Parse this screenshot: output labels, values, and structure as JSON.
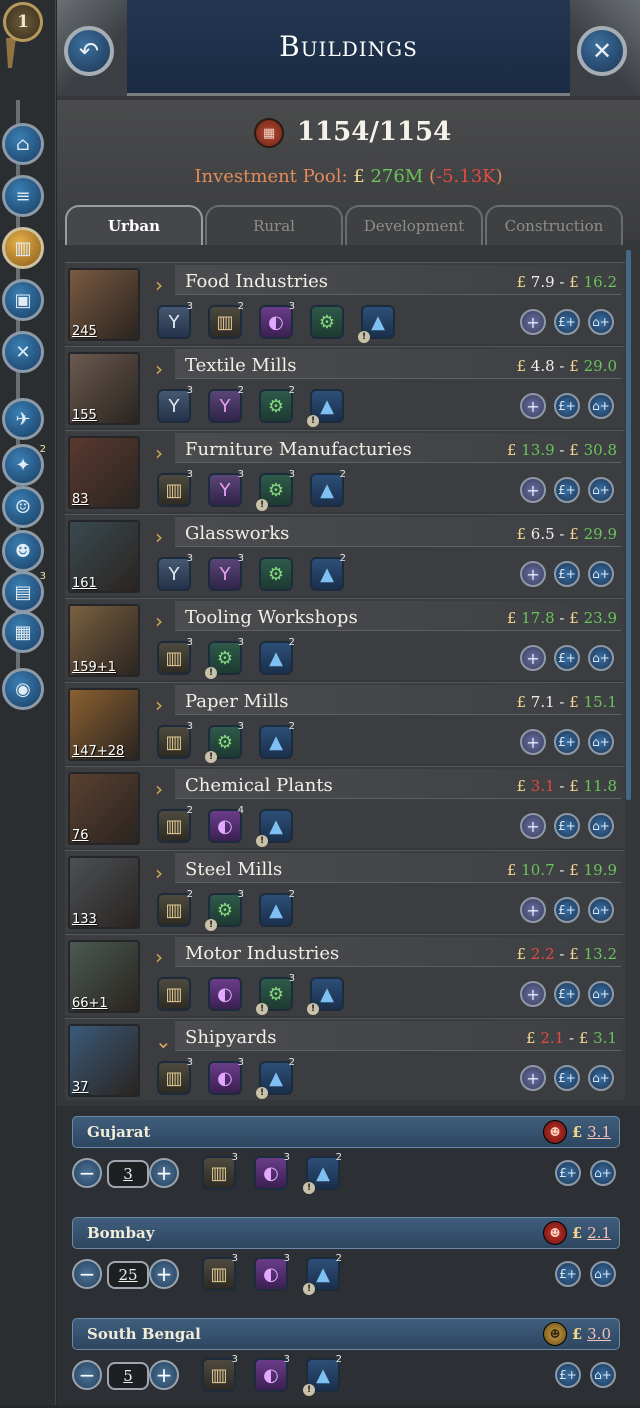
{
  "sidebar": {
    "rank": "1",
    "buttons": [
      {
        "icon": "government-icon",
        "badge": ""
      },
      {
        "icon": "budget-icon",
        "badge": ""
      },
      {
        "icon": "buildings-icon",
        "badge": "",
        "active": true
      },
      {
        "icon": "market-icon",
        "badge": ""
      },
      {
        "icon": "military-icon",
        "badge": ""
      },
      {
        "icon": "diplomacy-icon",
        "badge": ""
      },
      {
        "icon": "technology-icon",
        "badge": "2"
      },
      {
        "icon": "politics-icon",
        "badge": ""
      },
      {
        "icon": "population-icon",
        "badge": ""
      },
      {
        "icon": "journal-icon",
        "badge": "3"
      },
      {
        "icon": "ledger-icon",
        "badge": ""
      },
      {
        "icon": "map-icon",
        "badge": ""
      }
    ]
  },
  "header": {
    "title": "Buildings",
    "back_icon": "back-arrow-icon",
    "close_icon": "close-icon"
  },
  "summary": {
    "capacity": "1154/1154",
    "investment_label": "Investment Pool:",
    "currency": "£",
    "investment_value": "276M",
    "investment_delta": "-5.13K"
  },
  "tabs": [
    "Urban",
    "Rural",
    "Development",
    "Construction"
  ],
  "buildings": [
    {
      "name": "Food Industries",
      "count": "245",
      "range_low": "7.9",
      "range_high": "16.2",
      "low_color": "white",
      "pms": [
        {
          "t": "y",
          "lvl": "3"
        },
        {
          "t": "gold",
          "lvl": "2"
        },
        {
          "t": "purple",
          "lvl": "3"
        },
        {
          "t": "green",
          "lvl": ""
        },
        {
          "t": "blue",
          "lvl": "",
          "warn": true
        }
      ]
    },
    {
      "name": "Textile Mills",
      "count": "155",
      "range_low": "4.8",
      "range_high": "29.0",
      "low_color": "white",
      "pms": [
        {
          "t": "y",
          "lvl": "3"
        },
        {
          "t": "pink",
          "lvl": "2"
        },
        {
          "t": "green",
          "lvl": "2"
        },
        {
          "t": "blue",
          "lvl": "",
          "warn": true
        }
      ]
    },
    {
      "name": "Furniture Manufacturies",
      "count": "83",
      "range_low": "13.9",
      "range_high": "30.8",
      "low_color": "green",
      "pms": [
        {
          "t": "gold",
          "lvl": "3"
        },
        {
          "t": "pink",
          "lvl": "3"
        },
        {
          "t": "green",
          "lvl": "3",
          "warn": true
        },
        {
          "t": "blue",
          "lvl": "2"
        }
      ]
    },
    {
      "name": "Glassworks",
      "count": "161",
      "range_low": "6.5",
      "range_high": "29.9",
      "low_color": "white",
      "pms": [
        {
          "t": "y",
          "lvl": "3"
        },
        {
          "t": "pink",
          "lvl": "3"
        },
        {
          "t": "green",
          "lvl": ""
        },
        {
          "t": "blue",
          "lvl": "2"
        }
      ]
    },
    {
      "name": "Tooling Workshops",
      "count": "159+1",
      "range_low": "17.8",
      "range_high": "23.9",
      "low_color": "green",
      "pms": [
        {
          "t": "gold",
          "lvl": "3"
        },
        {
          "t": "green",
          "lvl": "3",
          "warn": true
        },
        {
          "t": "blue",
          "lvl": "2"
        }
      ]
    },
    {
      "name": "Paper Mills",
      "count": "147+28",
      "range_low": "7.1",
      "range_high": "15.1",
      "low_color": "white",
      "pms": [
        {
          "t": "gold",
          "lvl": "3"
        },
        {
          "t": "green",
          "lvl": "3",
          "warn": true
        },
        {
          "t": "blue",
          "lvl": "2"
        }
      ]
    },
    {
      "name": "Chemical Plants",
      "count": "76",
      "range_low": "3.1",
      "range_high": "11.8",
      "low_color": "red",
      "pms": [
        {
          "t": "gold",
          "lvl": "2"
        },
        {
          "t": "purple",
          "lvl": "4"
        },
        {
          "t": "blue",
          "lvl": "",
          "warn": true
        }
      ]
    },
    {
      "name": "Steel Mills",
      "count": "133",
      "range_low": "10.7",
      "range_high": "19.9",
      "low_color": "green",
      "pms": [
        {
          "t": "gold",
          "lvl": "2"
        },
        {
          "t": "green",
          "lvl": "3",
          "warn": true
        },
        {
          "t": "blue",
          "lvl": "2"
        }
      ]
    },
    {
      "name": "Motor Industries",
      "count": "66+1",
      "range_low": "2.2",
      "range_high": "13.2",
      "low_color": "red",
      "pms": [
        {
          "t": "gold",
          "lvl": ""
        },
        {
          "t": "purple",
          "lvl": ""
        },
        {
          "t": "green",
          "lvl": "3",
          "warn": true
        },
        {
          "t": "blue",
          "lvl": "",
          "warn": true
        }
      ]
    },
    {
      "name": "Shipyards",
      "count": "37",
      "range_low": "2.1",
      "range_high": "3.1",
      "low_color": "red",
      "expanded": true,
      "pms": [
        {
          "t": "gold",
          "lvl": "3"
        },
        {
          "t": "purple",
          "lvl": "3"
        },
        {
          "t": "blue",
          "lvl": "2",
          "warn": true
        }
      ]
    }
  ],
  "states": [
    {
      "name": "Gujarat",
      "value": "3.1",
      "qty": "3",
      "icon": "red"
    },
    {
      "name": "Bombay",
      "value": "2.1",
      "qty": "25",
      "icon": "red"
    },
    {
      "name": "South Bengal",
      "value": "3.0",
      "qty": "5",
      "icon": "gold"
    }
  ],
  "colors": {
    "accent_blue": "#1a2b42",
    "positive": "#69c45a",
    "negative": "#e24a43",
    "gold": "#d7a85a"
  }
}
